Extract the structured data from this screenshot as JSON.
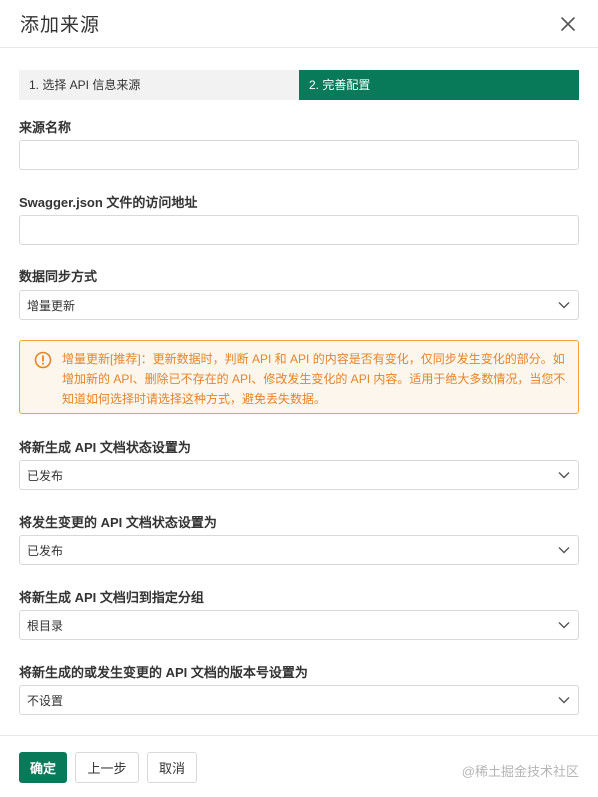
{
  "dialog": {
    "title": "添加来源",
    "close_icon": "close-icon"
  },
  "steps": [
    {
      "label": "1. 选择 API 信息来源",
      "active": false
    },
    {
      "label": "2. 完善配置",
      "active": true
    }
  ],
  "form": {
    "source_name": {
      "label": "来源名称",
      "value": ""
    },
    "swagger_url": {
      "label": "Swagger.json 文件的访问地址",
      "value": ""
    },
    "sync_mode": {
      "label": "数据同步方式",
      "value": "增量更新"
    },
    "warning": {
      "icon": "info-circle-icon",
      "text": "增量更新[推荐]：更新数据时，判断 API 和 API 的内容是否有变化，仅同步发生变化的部分。如增加新的 API、删除已不存在的 API、修改发生变化的 API 内容。适用于绝大多数情况，当您不知道如何选择时请选择这种方式，避免丢失数据。"
    },
    "new_doc_status": {
      "label": "将新生成 API 文档状态设置为",
      "value": "已发布"
    },
    "changed_doc_status": {
      "label": "将发生变更的 API 文档状态设置为",
      "value": "已发布"
    },
    "new_doc_group": {
      "label": "将新生成 API 文档归到指定分组",
      "value": "根目录"
    },
    "version": {
      "label": "将新生成的或发生变更的 API 文档的版本号设置为",
      "value": "不设置"
    }
  },
  "footer": {
    "confirm_label": "确定",
    "prev_label": "上一步",
    "cancel_label": "取消",
    "watermark": "@稀土掘金技术社区"
  },
  "colors": {
    "primary": "#087a5a",
    "warning_border": "#f0a43a",
    "warning_bg": "#fdf6ec",
    "warning_text": "#e5832a"
  }
}
